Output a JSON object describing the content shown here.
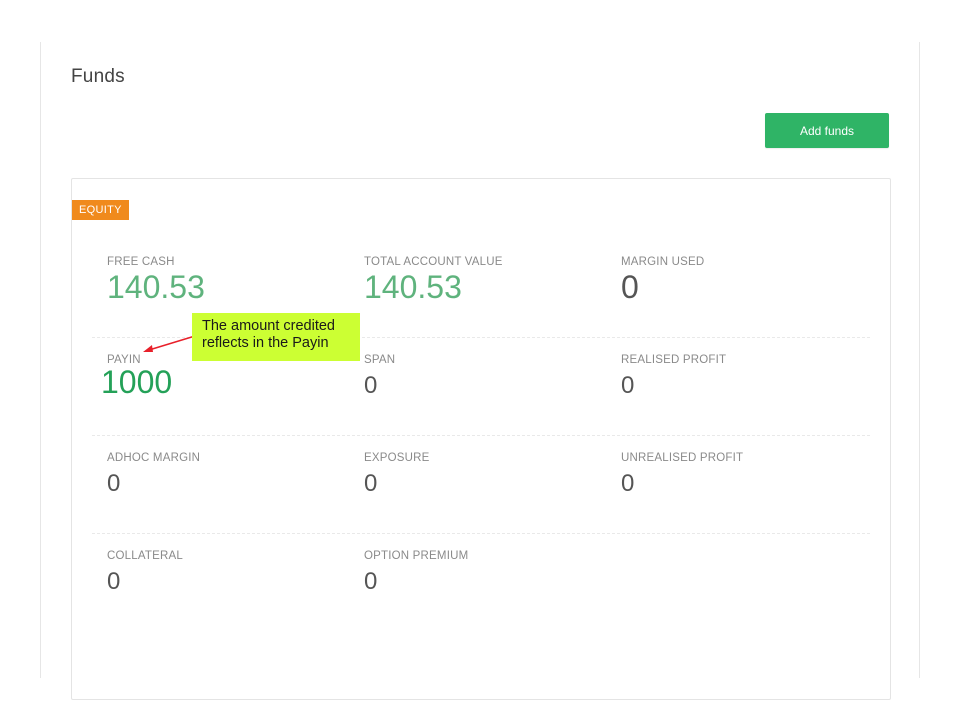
{
  "page": {
    "title": "Funds"
  },
  "actions": {
    "add_funds_label": "Add funds",
    "add_funds_color": "#2fb466"
  },
  "equity": {
    "badge": "EQUITY",
    "badge_color": "#f08a1c",
    "metrics": {
      "free_cash": {
        "label": "FREE CASH",
        "value": "140.53"
      },
      "total_account_value": {
        "label": "TOTAL ACCOUNT VALUE",
        "value": "140.53"
      },
      "margin_used": {
        "label": "MARGIN USED",
        "value": "0"
      },
      "payin": {
        "label": "PAYIN",
        "value": "1000"
      },
      "span": {
        "label": "SPAN",
        "value": "0"
      },
      "realised_profit": {
        "label": "REALISED PROFIT",
        "value": "0"
      },
      "adhoc_margin": {
        "label": "ADHOC MARGIN",
        "value": "0"
      },
      "exposure": {
        "label": "EXPOSURE",
        "value": "0"
      },
      "unrealised_profit": {
        "label": "UNREALISED PROFIT",
        "value": "0"
      },
      "collateral": {
        "label": "COLLATERAL",
        "value": "0"
      },
      "option_premium": {
        "label": "OPTION PREMIUM",
        "value": "0"
      }
    }
  },
  "annotation": {
    "line1": "The amount credited",
    "line2": "reflects in the Payin",
    "background": "#ccff33",
    "arrow_color": "#e8202a"
  }
}
